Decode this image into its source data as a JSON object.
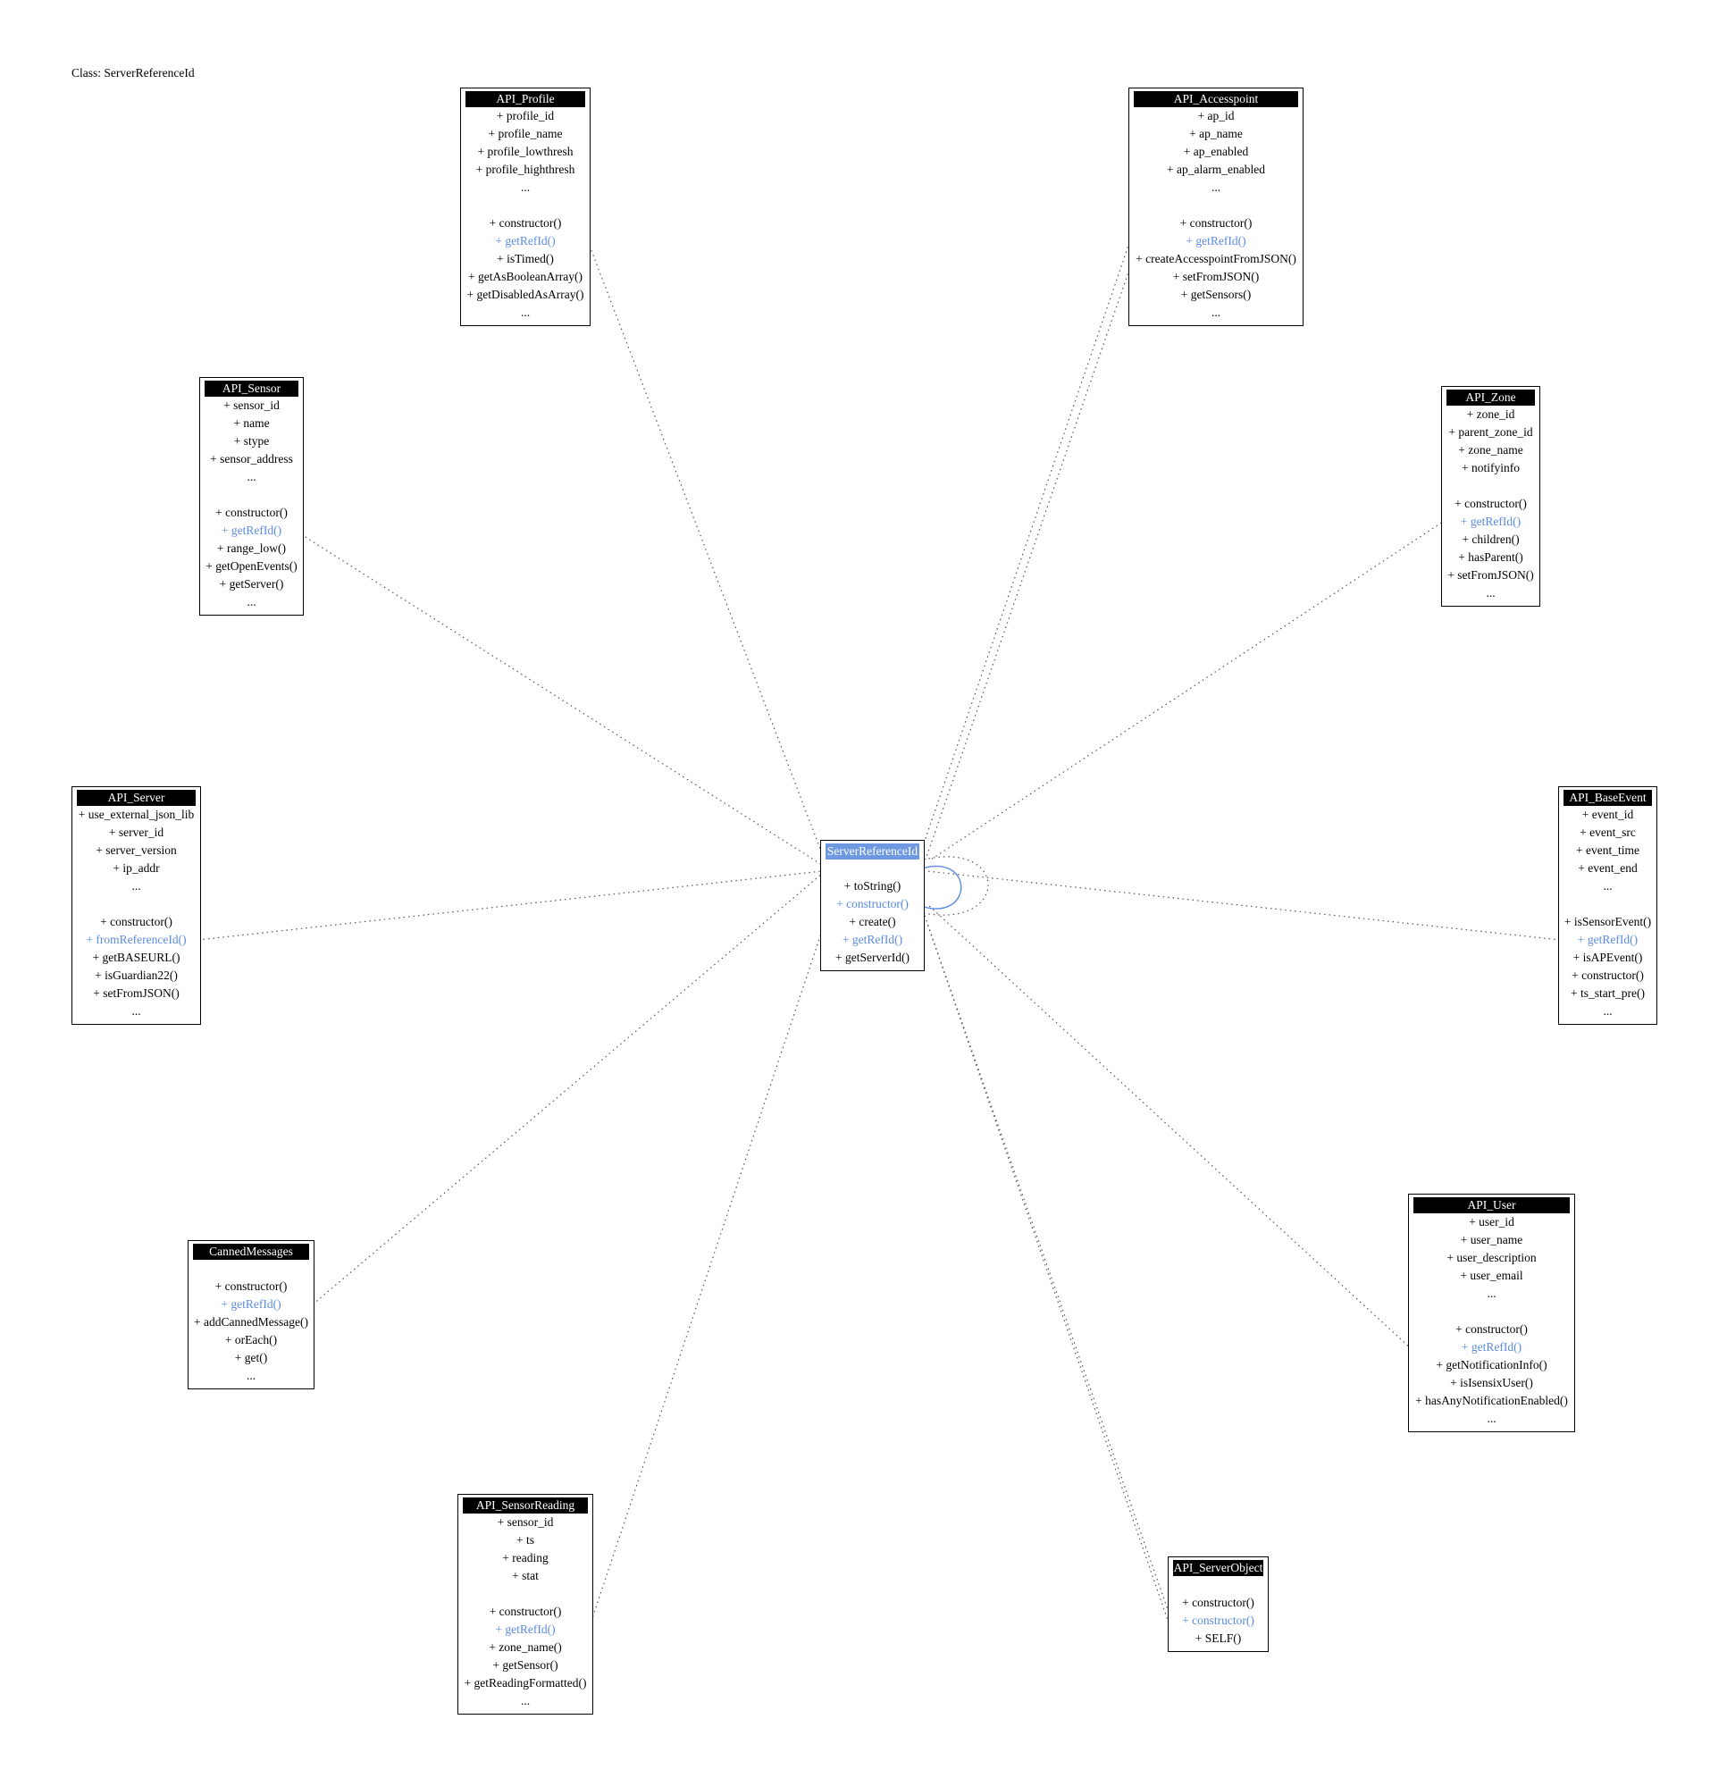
{
  "title": "Class: ServerReferenceId",
  "highlight_color": "#5b8be0",
  "center_header_color": "#6e98e0",
  "classes": {
    "profile": {
      "name": "API_Profile",
      "fields": [
        "+ profile_id",
        "+ profile_name",
        "+ profile_lowthresh",
        "+ profile_highthresh",
        "..."
      ],
      "methods": [
        {
          "text": "+ constructor()",
          "hl": false
        },
        {
          "text": "+ getRefId()",
          "hl": true
        },
        {
          "text": "+ isTimed()",
          "hl": false
        },
        {
          "text": "+ getAsBooleanArray()",
          "hl": false
        },
        {
          "text": "+ getDisabledAsArray()",
          "hl": false
        },
        {
          "text": "...",
          "hl": false
        }
      ]
    },
    "accesspoint": {
      "name": "API_Accesspoint",
      "fields": [
        "+ ap_id",
        "+ ap_name",
        "+ ap_enabled",
        "+ ap_alarm_enabled",
        "..."
      ],
      "methods": [
        {
          "text": "+ constructor()",
          "hl": false
        },
        {
          "text": "+ getRefId()",
          "hl": true
        },
        {
          "text": "+ createAccesspointFromJSON()",
          "hl": false
        },
        {
          "text": "+ setFromJSON()",
          "hl": false
        },
        {
          "text": "+ getSensors()",
          "hl": false
        },
        {
          "text": "...",
          "hl": false
        }
      ]
    },
    "sensor": {
      "name": "API_Sensor",
      "fields": [
        "+ sensor_id",
        "+ name",
        "+ stype",
        "+ sensor_address",
        "..."
      ],
      "methods": [
        {
          "text": "+ constructor()",
          "hl": false
        },
        {
          "text": "+ getRefId()",
          "hl": true
        },
        {
          "text": "+ range_low()",
          "hl": false
        },
        {
          "text": "+ getOpenEvents()",
          "hl": false
        },
        {
          "text": "+ getServer()",
          "hl": false
        },
        {
          "text": "...",
          "hl": false
        }
      ]
    },
    "zone": {
      "name": "API_Zone",
      "fields": [
        "+ zone_id",
        "+ parent_zone_id",
        "+ zone_name",
        "+ notifyinfo"
      ],
      "methods": [
        {
          "text": "+ constructor()",
          "hl": false
        },
        {
          "text": "+ getRefId()",
          "hl": true
        },
        {
          "text": "+ children()",
          "hl": false
        },
        {
          "text": "+ hasParent()",
          "hl": false
        },
        {
          "text": "+ setFromJSON()",
          "hl": false
        },
        {
          "text": "...",
          "hl": false
        }
      ]
    },
    "server": {
      "name": "API_Server",
      "fields": [
        "+ use_external_json_lib",
        "+ server_id",
        "+ server_version",
        "+ ip_addr",
        "..."
      ],
      "methods": [
        {
          "text": "+ constructor()",
          "hl": false
        },
        {
          "text": "+ fromReferenceId()",
          "hl": true
        },
        {
          "text": "+ getBASEURL()",
          "hl": false
        },
        {
          "text": "+ isGuardian22()",
          "hl": false
        },
        {
          "text": "+ setFromJSON()",
          "hl": false
        },
        {
          "text": "...",
          "hl": false
        }
      ]
    },
    "center": {
      "name": "ServerReferenceId",
      "fields": [],
      "methods": [
        {
          "text": "+ toString()",
          "hl": false
        },
        {
          "text": "+ constructor()",
          "hl": true
        },
        {
          "text": "+ create()",
          "hl": false
        },
        {
          "text": "+ getRefId()",
          "hl": true
        },
        {
          "text": "+ getServerId()",
          "hl": false
        }
      ]
    },
    "baseevent": {
      "name": "API_BaseEvent",
      "fields": [
        "+ event_id",
        "+ event_src",
        "+ event_time",
        "+ event_end",
        "..."
      ],
      "methods": [
        {
          "text": "+ isSensorEvent()",
          "hl": false
        },
        {
          "text": "+ getRefId()",
          "hl": true
        },
        {
          "text": "+ isAPEvent()",
          "hl": false
        },
        {
          "text": "+ constructor()",
          "hl": false
        },
        {
          "text": "+ ts_start_pre()",
          "hl": false
        },
        {
          "text": "...",
          "hl": false
        }
      ]
    },
    "canned": {
      "name": "CannedMessages",
      "fields": [],
      "methods": [
        {
          "text": "+ constructor()",
          "hl": false
        },
        {
          "text": "+ getRefId()",
          "hl": true
        },
        {
          "text": "+ addCannedMessage()",
          "hl": false
        },
        {
          "text": "+ orEach()",
          "hl": false
        },
        {
          "text": "+ get()",
          "hl": false
        },
        {
          "text": "...",
          "hl": false
        }
      ]
    },
    "user": {
      "name": "API_User",
      "fields": [
        "+ user_id",
        "+ user_name",
        "+ user_description",
        "+ user_email",
        "..."
      ],
      "methods": [
        {
          "text": "+ constructor()",
          "hl": false
        },
        {
          "text": "+ getRefId()",
          "hl": true
        },
        {
          "text": "+ getNotificationInfo()",
          "hl": false
        },
        {
          "text": "+ isIsensixUser()",
          "hl": false
        },
        {
          "text": "+ hasAnyNotificationEnabled()",
          "hl": false
        },
        {
          "text": "...",
          "hl": false
        }
      ]
    },
    "reading": {
      "name": "API_SensorReading",
      "fields": [
        "+ sensor_id",
        "+ ts",
        "+ reading",
        "+ stat"
      ],
      "methods": [
        {
          "text": "+ constructor()",
          "hl": false
        },
        {
          "text": "+ getRefId()",
          "hl": true
        },
        {
          "text": "+ zone_name()",
          "hl": false
        },
        {
          "text": "+ getSensor()",
          "hl": false
        },
        {
          "text": "+ getReadingFormatted()",
          "hl": false
        },
        {
          "text": "...",
          "hl": false
        }
      ]
    },
    "serverobject": {
      "name": "API_ServerObject",
      "fields": [],
      "methods": [
        {
          "text": "+ constructor()",
          "hl": false
        },
        {
          "text": "+ constructor()",
          "hl": true
        },
        {
          "text": "+ SELF()",
          "hl": false
        }
      ]
    }
  }
}
